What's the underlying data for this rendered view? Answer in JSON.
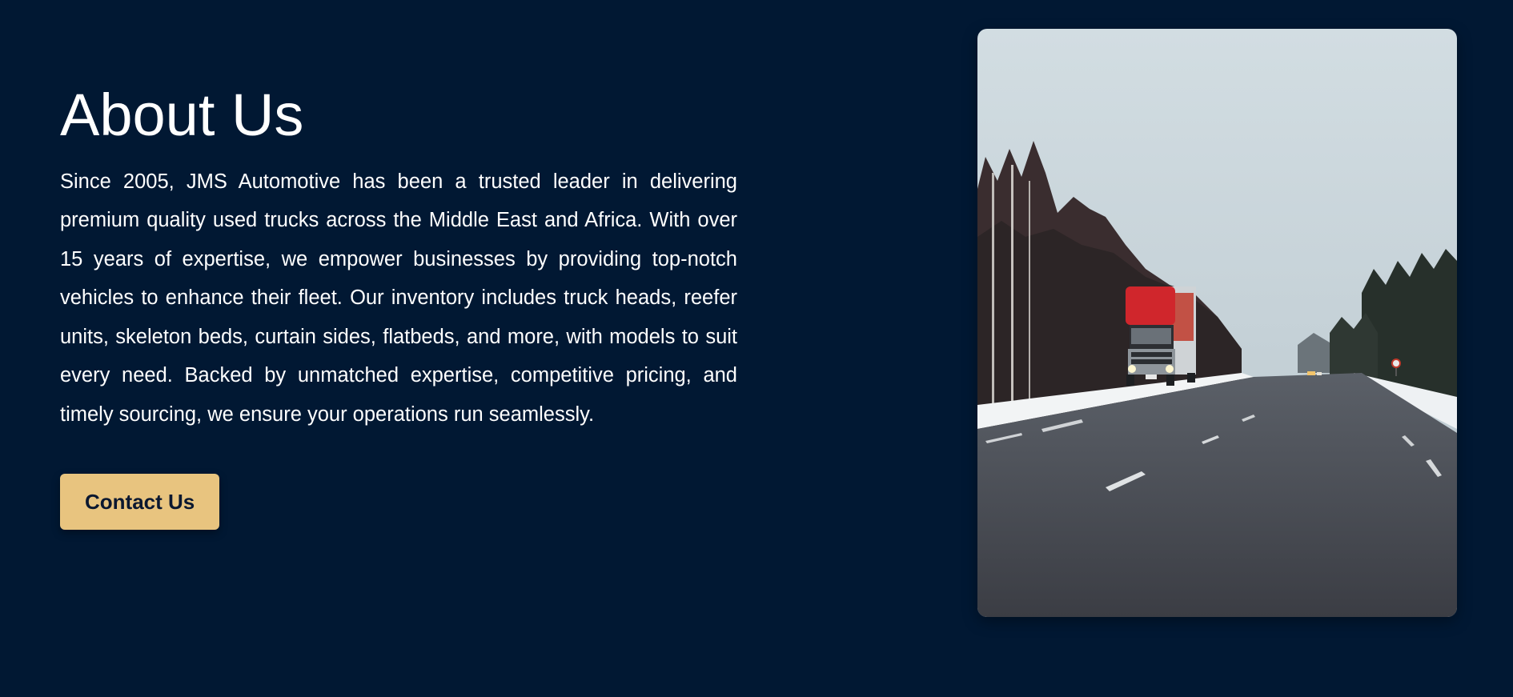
{
  "about": {
    "title": "About Us",
    "description": "Since 2005, JMS Automotive has been a trusted leader in delivering premium quality used trucks across the Middle East and Africa. With over 15 years of expertise, we empower businesses by providing top-notch vehicles to enhance their fleet. Our inventory includes truck heads, reefer units, skeleton beds, curtain sides, flatbeds, and more, with models to suit every need. Backed by unmatched expertise, competitive pricing, and timely sourcing, we ensure your operations run seamlessly.",
    "cta_label": "Contact Us"
  },
  "image": {
    "subject": "red truck on snowy road"
  },
  "colors": {
    "background": "#011833",
    "accent": "#e8c47f",
    "text": "#ffffff",
    "button_text": "#0b1830"
  }
}
